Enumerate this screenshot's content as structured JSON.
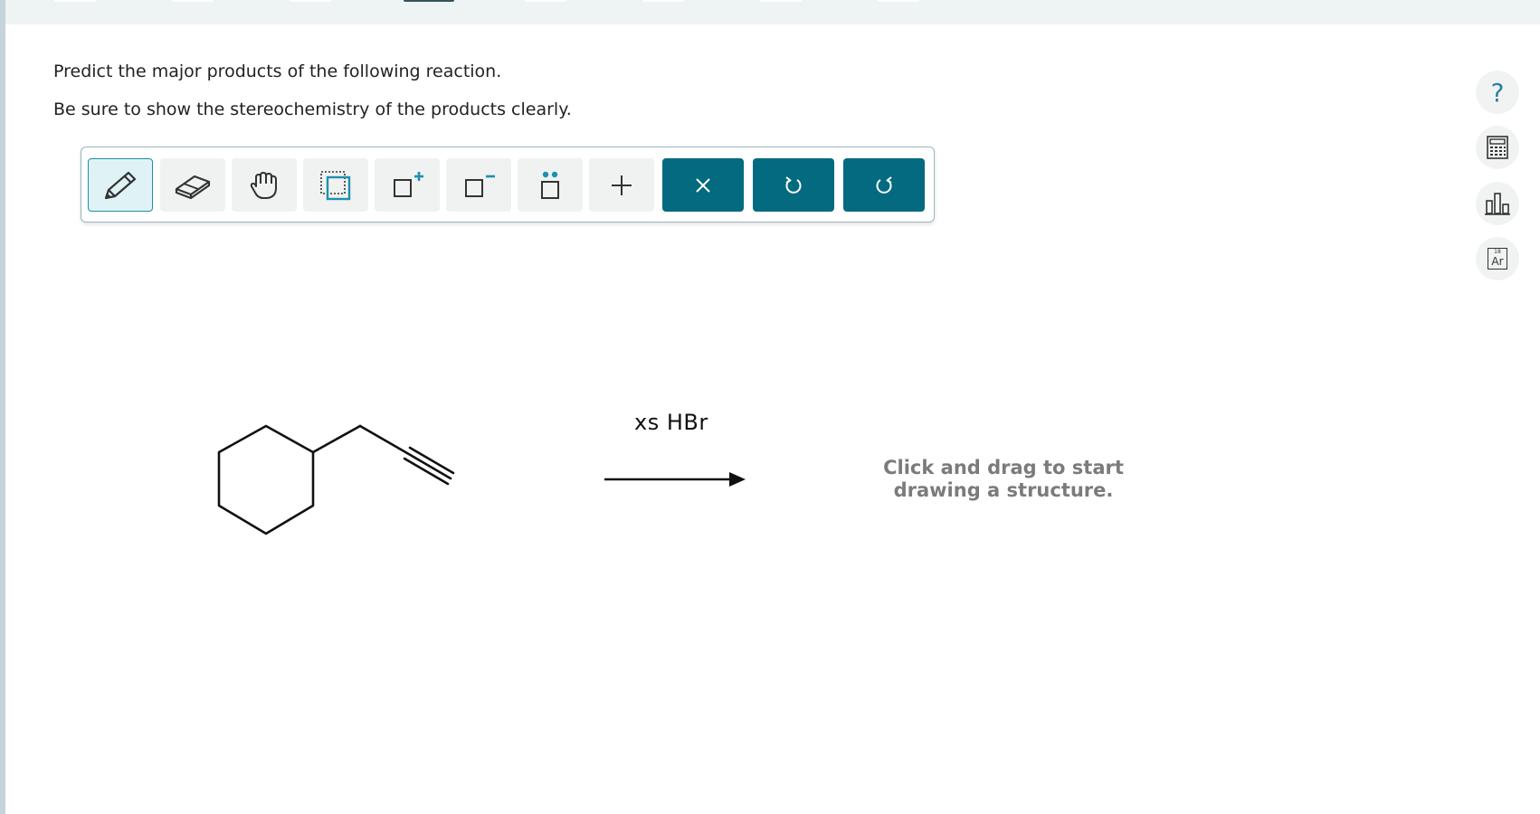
{
  "question": {
    "line1": "Predict the major products of the following reaction.",
    "line2": "Be sure to show the stereochemistry of the products clearly."
  },
  "toolbar": {
    "tools": [
      {
        "name": "pencil",
        "icon": "pencil-icon",
        "selected": true
      },
      {
        "name": "eraser",
        "icon": "eraser-icon"
      },
      {
        "name": "move",
        "icon": "hand-icon"
      },
      {
        "name": "selection",
        "icon": "selection-box-icon"
      },
      {
        "name": "positive-charge",
        "icon": "charge-plus-icon",
        "label": "+"
      },
      {
        "name": "negative-charge",
        "icon": "charge-minus-icon",
        "label": "−"
      },
      {
        "name": "lone-pair",
        "icon": "lone-pair-icon"
      },
      {
        "name": "add",
        "icon": "plus-icon",
        "label": "+"
      }
    ],
    "actions": [
      {
        "name": "clear",
        "icon": "close-icon",
        "label": "×"
      },
      {
        "name": "undo",
        "icon": "undo-icon"
      },
      {
        "name": "redo",
        "icon": "redo-icon"
      }
    ],
    "colors": {
      "accent": "#036a7f",
      "selected_bg": "#dff3f7",
      "tool_bg": "#f0f2f2"
    }
  },
  "side_tools": [
    {
      "name": "help",
      "icon": "question-icon",
      "label": "?"
    },
    {
      "name": "calculator",
      "icon": "calculator-icon"
    },
    {
      "name": "data-chart",
      "icon": "bar-chart-icon"
    },
    {
      "name": "periodic-table",
      "icon": "periodic-table-icon",
      "number": "18",
      "symbol": "Ar"
    }
  ],
  "reaction": {
    "reactant": "3-cyclohexylpropyne skeletal structure",
    "reagent": "xs HBr",
    "arrow": "right-arrow"
  },
  "canvas": {
    "hint": "Click and drag to start drawing a structure."
  }
}
